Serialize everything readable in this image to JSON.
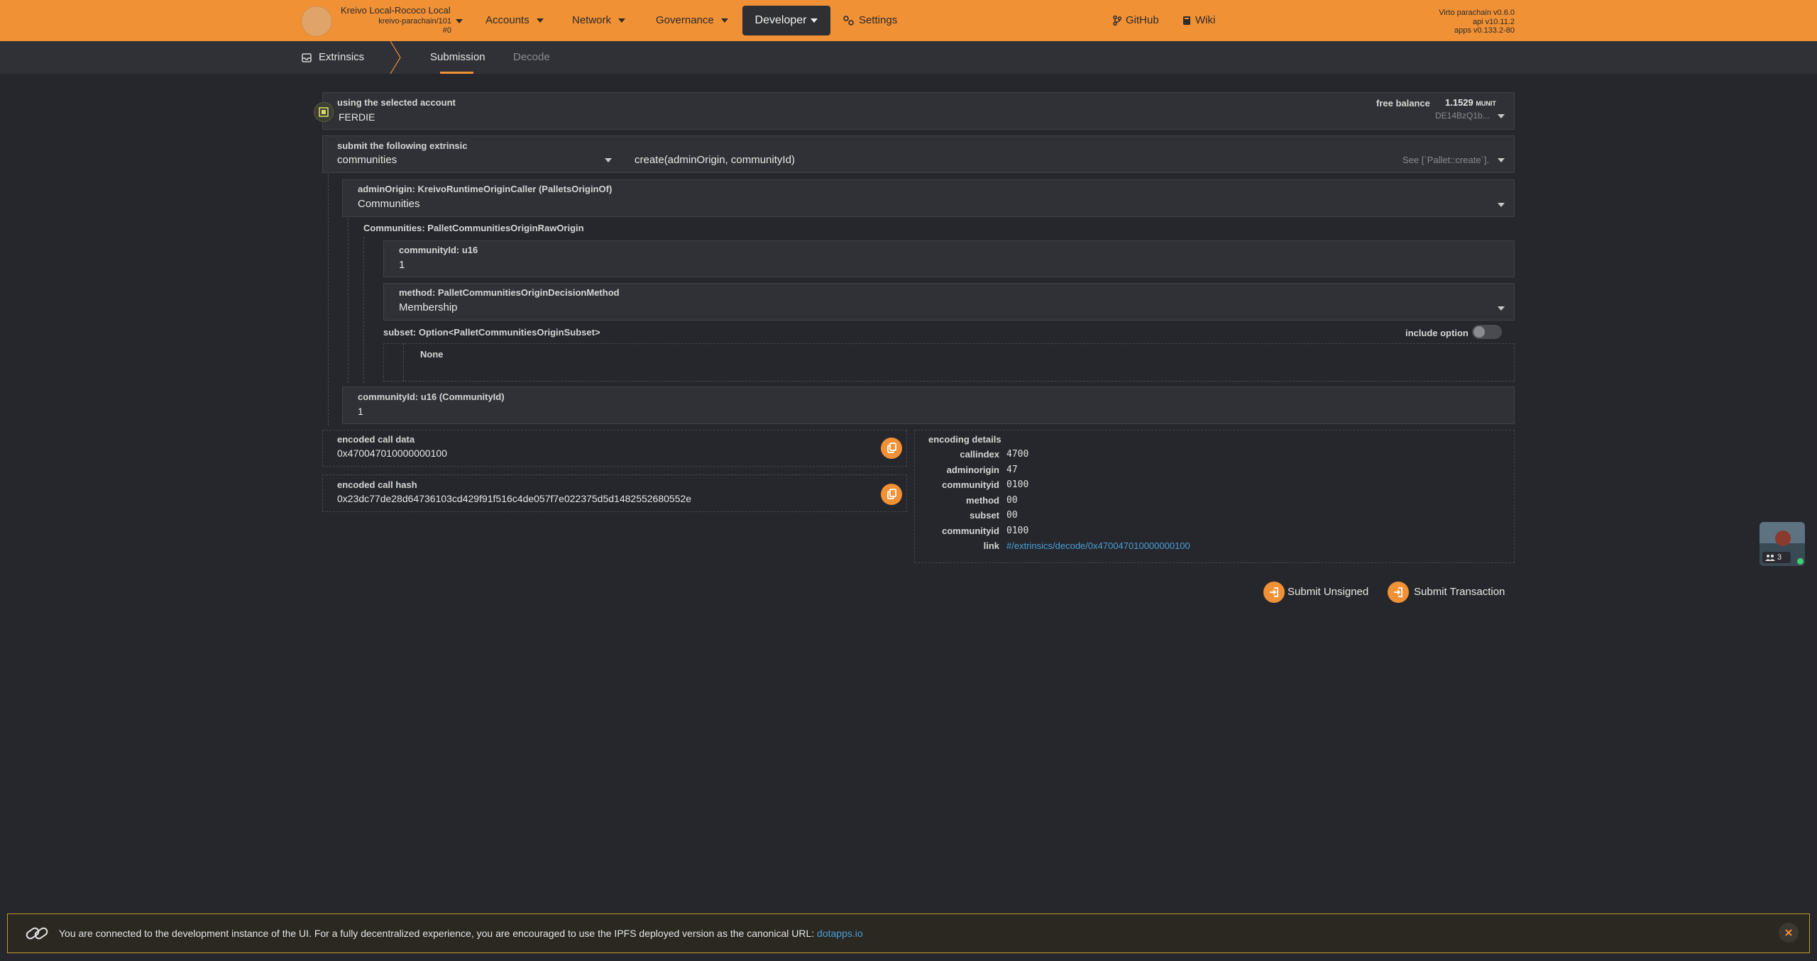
{
  "topbar": {
    "chain_name": "Kreivo Local-Rococo Local",
    "chain_sub": "kreivo-parachain/101",
    "block": "#0",
    "nav": {
      "accounts": "Accounts",
      "network": "Network",
      "governance": "Governance",
      "developer": "Developer",
      "settings": "Settings",
      "github": "GitHub",
      "wiki": "Wiki"
    },
    "versions": [
      "Virto parachain v0.6.0",
      "api v10.11.2",
      "apps v0.133.2-80"
    ]
  },
  "subbar": {
    "section": "Extrinsics",
    "tabs": [
      "Submission",
      "Decode"
    ],
    "active_tab": "Submission"
  },
  "account": {
    "label": "using the selected account",
    "name": "FERDIE",
    "balance_label": "free balance",
    "balance_value": "1.1529",
    "balance_unit": "MUNIT",
    "address": "DE14BzQ1b..."
  },
  "extrinsic": {
    "label": "submit the following extrinsic",
    "pallet": "communities",
    "call": "create(adminOrigin, communityId)",
    "doc": "See [`Pallet::create`]."
  },
  "params": {
    "admin_origin_label": "adminOrigin: KreivoRuntimeOriginCaller (PalletsOriginOf)",
    "admin_origin_value": "Communities",
    "communities_label": "Communities: PalletCommunitiesOriginRawOrigin",
    "community_id_inner_label": "communityId: u16",
    "community_id_inner_value": "1",
    "method_label": "method: PalletCommunitiesOriginDecisionMethod",
    "method_value": "Membership",
    "subset_label": "subset: Option<PalletCommunitiesOriginSubset>",
    "include_option_label": "include option",
    "subset_value": "None",
    "community_id_label": "communityId: u16 (CommunityId)",
    "community_id_value": "1"
  },
  "encoded": {
    "call_data_label": "encoded call data",
    "call_data": "0x470047010000000100",
    "call_hash_label": "encoded call hash",
    "call_hash": "0x23dc77de28d64736103cd429f91f516c4de057f7e022375d5d1482552680552e"
  },
  "encoding_details": {
    "title": "encoding details",
    "rows": [
      {
        "key": "callindex",
        "value": "4700"
      },
      {
        "key": "adminorigin",
        "value": "47"
      },
      {
        "key": "communityid",
        "value": "0100"
      },
      {
        "key": "method",
        "value": "00"
      },
      {
        "key": "subset",
        "value": "00"
      },
      {
        "key": "communityid",
        "value": "0100"
      }
    ],
    "link_key": "link",
    "link_value": "#/extrinsics/decode/0x470047010000000100"
  },
  "actions": {
    "submit_unsigned": "Submit Unsigned",
    "submit_transaction": "Submit Transaction"
  },
  "peers": {
    "count": "3"
  },
  "notice": {
    "text": "You are connected to the development instance of the UI. For a fully decentralized experience, you are encouraged to use the IPFS deployed version as the canonical URL:",
    "link": "dotapps.io"
  },
  "colors": {
    "accent": "#f19135",
    "background": "#26272c",
    "panel": "#303136",
    "link": "#4a9fd8",
    "notice_border": "#c79a24"
  },
  "icons": [
    "extrinsics-icon",
    "settings-icon",
    "github-icon",
    "wiki-icon",
    "copy-icon",
    "submit-icon",
    "link-icon",
    "close-icon",
    "peers-icon"
  ]
}
